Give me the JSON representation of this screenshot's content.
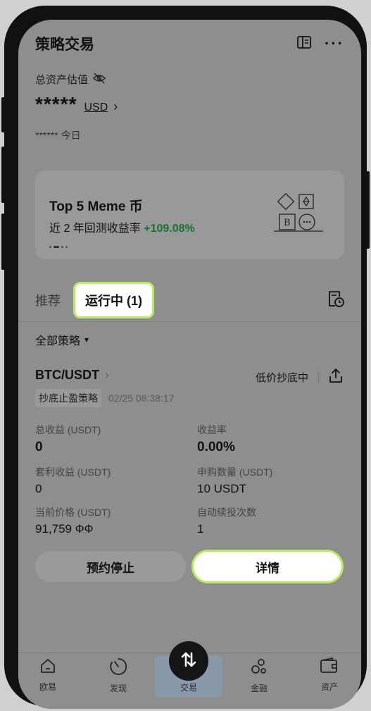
{
  "header": {
    "title": "策略交易"
  },
  "assets": {
    "label": "总资产估值",
    "value_masked": "*****",
    "currency": "USD",
    "currency_chevron": "›",
    "today_masked": "******",
    "today_label": "今日"
  },
  "banner": {
    "title": "Top 5 Meme 币",
    "subtitle_prefix": "近 2 年回测收益率",
    "return_pct": "+109.08%",
    "page_count": 4,
    "active_page": 2,
    "return_color": "#16732e"
  },
  "tabs": {
    "recommended": "推荐",
    "running": "运行中 (1)"
  },
  "filter": {
    "label": "全部策略",
    "arrow": "▾"
  },
  "strategy": {
    "pair": "BTC/USDT",
    "pair_chevron": "›",
    "status": "低价抄底中",
    "type": "抄底止盈策略",
    "time": "02/25 08:38:17",
    "metrics": [
      {
        "label": "总收益 (USDT)",
        "value": "0"
      },
      {
        "label": "收益率",
        "value": "0.00%"
      },
      {
        "label": "套利收益 (USDT)",
        "value": "0"
      },
      {
        "label": "申购数量 (USDT)",
        "value": "10 USDT"
      },
      {
        "label": "当前价格 (USDT)",
        "value": "91,759 ФФ"
      },
      {
        "label": "自动续投次数",
        "value": "1"
      }
    ],
    "stop_button": "预约停止",
    "detail_button": "详情"
  },
  "tabbar": {
    "items": [
      {
        "label": "欧易",
        "icon": "home-icon"
      },
      {
        "label": "发现",
        "icon": "discover-icon"
      },
      {
        "label": "交易",
        "icon": "trade-icon"
      },
      {
        "label": "金融",
        "icon": "finance-icon"
      },
      {
        "label": "资产",
        "icon": "wallet-icon"
      }
    ]
  },
  "colors": {
    "accent_outline": "#b6ee5a",
    "screen_overlay": "#8e8e8e"
  }
}
